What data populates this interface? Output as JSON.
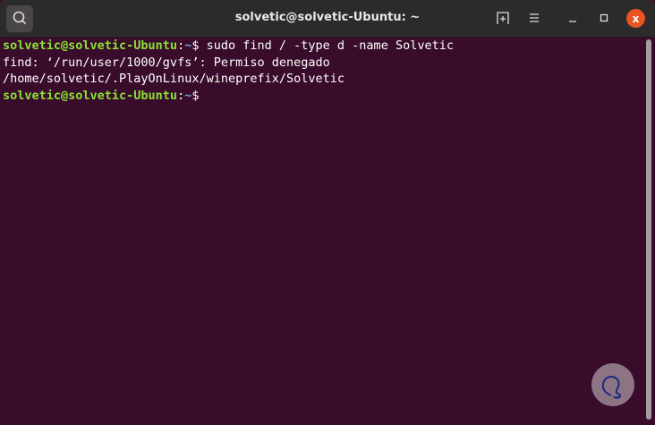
{
  "window": {
    "title": "solvetic@solvetic-Ubuntu: ~",
    "close_label": "x"
  },
  "terminal": {
    "lines": [
      {
        "user": "solvetic@solvetic-Ubuntu",
        "sep": ":",
        "path": "~",
        "prompt": "$ ",
        "cmd": "sudo find / -type d -name Solvetic"
      },
      {
        "text": "find: ‘/run/user/1000/gvfs’: Permiso denegado"
      },
      {
        "text": "/home/solvetic/.PlayOnLinux/wineprefix/Solvetic"
      },
      {
        "user": "solvetic@solvetic-Ubuntu",
        "sep": ":",
        "path": "~",
        "prompt": "$",
        "cmd": ""
      }
    ]
  },
  "watermark": {
    "text": "Solvetic"
  },
  "colors": {
    "bg": "#380c2a",
    "user": "#8ae234",
    "path": "#729fcf",
    "close": "#e95420"
  }
}
